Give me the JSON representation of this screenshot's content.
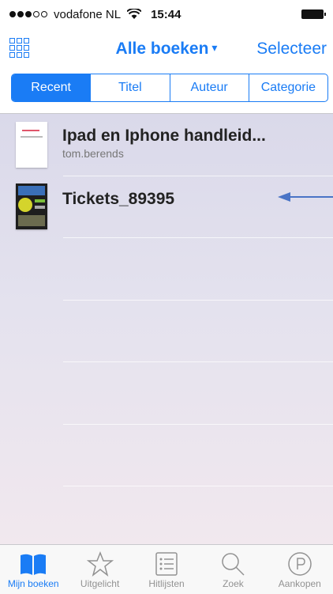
{
  "status_bar": {
    "carrier": "vodafone NL",
    "wifi_icon": "wifi-icon",
    "time": "15:44"
  },
  "nav": {
    "title": "Alle boeken",
    "title_caret": "▾",
    "select_label": "Selecteer",
    "grid_icon": "grid-view-icon"
  },
  "segments": [
    {
      "label": "Recent",
      "active": true
    },
    {
      "label": "Titel",
      "active": false
    },
    {
      "label": "Auteur",
      "active": false
    },
    {
      "label": "Categorie",
      "active": false
    }
  ],
  "books": [
    {
      "title": "Ipad en Iphone handleid...",
      "author": "tom.berends"
    },
    {
      "title": "Tickets_89395",
      "author": ""
    }
  ],
  "annotation": {
    "arrow_color": "#4a74c6",
    "icon": "arrow-left-icon"
  },
  "tabs": [
    {
      "label": "Mijn boeken",
      "icon": "open-book-icon",
      "active": true
    },
    {
      "label": "Uitgelicht",
      "icon": "star-icon",
      "active": false
    },
    {
      "label": "Hitlijsten",
      "icon": "list-icon",
      "active": false
    },
    {
      "label": "Zoek",
      "icon": "search-icon",
      "active": false
    },
    {
      "label": "Aankopen",
      "icon": "purchases-icon",
      "active": false
    }
  ],
  "colors": {
    "accent": "#1a7cf5",
    "inactive_tab": "#929292"
  }
}
